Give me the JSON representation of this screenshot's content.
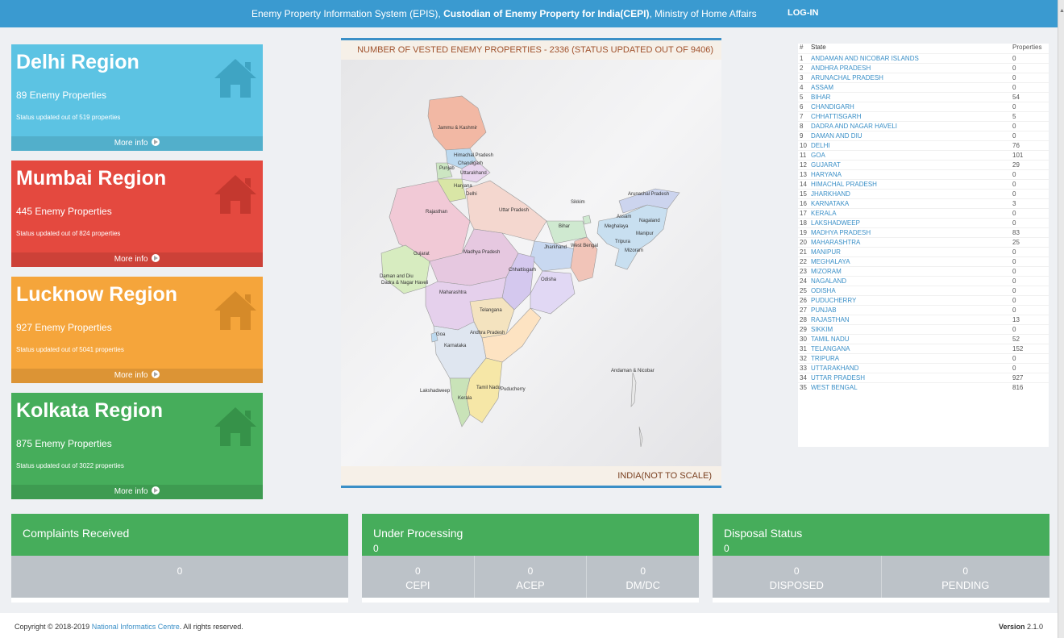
{
  "header": {
    "title_part1": "Enemy Property Information System (EPIS), ",
    "title_bold": "Custodian of Enemy Property for India(CEPI)",
    "title_part2": ", Ministry of Home Affairs",
    "login_label": "LOG-IN",
    "color": "#3a9ad0"
  },
  "regions": [
    {
      "name": "Delhi Region",
      "count": "89 Enemy Properties",
      "status": "Status updated out of 519 properties",
      "more": "More info",
      "color": "#5cc3e3"
    },
    {
      "name": "Mumbai Region",
      "count": "445 Enemy Properties",
      "status": "Status updated out of 824 properties",
      "more": "More info",
      "color": "#e4493f"
    },
    {
      "name": "Lucknow Region",
      "count": "927 Enemy Properties",
      "status": "Status updated out of 5041 properties",
      "more": "More info",
      "color": "#f5a53b"
    },
    {
      "name": "Kolkata Region",
      "count": "875 Enemy Properties",
      "status": "Status updated out of 3022 properties",
      "more": "More info",
      "color": "#46ad5b"
    }
  ],
  "map": {
    "heading": "NUMBER OF VESTED ENEMY PROPERTIES - 2336 (STATUS UPDATED OUT OF 9406)",
    "footer": "INDIA(NOT TO SCALE)",
    "labels": [
      "Jammu & Kashmir",
      "Himachal Pradesh",
      "Punjab",
      "Chandigarh",
      "Uttarakhand",
      "Haryana",
      "Delhi",
      "Rajasthan",
      "Uttar Pradesh",
      "Sikkim",
      "Arunachal Pradesh",
      "Bihar",
      "Assam",
      "Nagaland",
      "Meghalaya",
      "Manipur",
      "Tripura",
      "Mizoram",
      "Jharkhand",
      "West Bengal",
      "Gujarat",
      "Madhya Pradesh",
      "Chhattisgarh",
      "Daman and Diu",
      "Dadra & Nagar Haveli",
      "Odisha",
      "Maharashtra",
      "Telangana",
      "Goa",
      "Andhra Pradesh",
      "Karnataka",
      "Andaman & Nicobar",
      "Lakshadweep",
      "Tamil Nadu",
      "Puducherry",
      "Kerala"
    ]
  },
  "state_table": {
    "headers": [
      "#",
      "State",
      "Properties"
    ],
    "rows": [
      [
        "1",
        "ANDAMAN AND NICOBAR ISLANDS",
        "0"
      ],
      [
        "2",
        "ANDHRA PRADESH",
        "0"
      ],
      [
        "3",
        "ARUNACHAL PRADESH",
        "0"
      ],
      [
        "4",
        "ASSAM",
        "0"
      ],
      [
        "5",
        "BIHAR",
        "54"
      ],
      [
        "6",
        "CHANDIGARH",
        "0"
      ],
      [
        "7",
        "CHHATTISGARH",
        "5"
      ],
      [
        "8",
        "DADRA AND NAGAR HAVELI",
        "0"
      ],
      [
        "9",
        "DAMAN AND DIU",
        "0"
      ],
      [
        "10",
        "DELHI",
        "76"
      ],
      [
        "11",
        "GOA",
        "101"
      ],
      [
        "12",
        "GUJARAT",
        "29"
      ],
      [
        "13",
        "HARYANA",
        "0"
      ],
      [
        "14",
        "HIMACHAL PRADESH",
        "0"
      ],
      [
        "15",
        "JHARKHAND",
        "0"
      ],
      [
        "16",
        "KARNATAKA",
        "3"
      ],
      [
        "17",
        "KERALA",
        "0"
      ],
      [
        "18",
        "LAKSHADWEEP",
        "0"
      ],
      [
        "19",
        "MADHYA PRADESH",
        "83"
      ],
      [
        "20",
        "MAHARASHTRA",
        "25"
      ],
      [
        "21",
        "MANIPUR",
        "0"
      ],
      [
        "22",
        "MEGHALAYA",
        "0"
      ],
      [
        "23",
        "MIZORAM",
        "0"
      ],
      [
        "24",
        "NAGALAND",
        "0"
      ],
      [
        "25",
        "ODISHA",
        "0"
      ],
      [
        "26",
        "PUDUCHERRY",
        "0"
      ],
      [
        "27",
        "PUNJAB",
        "0"
      ],
      [
        "28",
        "RAJASTHAN",
        "13"
      ],
      [
        "29",
        "SIKKIM",
        "0"
      ],
      [
        "30",
        "TAMIL NADU",
        "52"
      ],
      [
        "31",
        "TELANGANA",
        "152"
      ],
      [
        "32",
        "TRIPURA",
        "0"
      ],
      [
        "33",
        "UTTARAKHAND",
        "0"
      ],
      [
        "34",
        "UTTAR PRADESH",
        "927"
      ],
      [
        "35",
        "WEST BENGAL",
        "816"
      ]
    ]
  },
  "stats": {
    "complaints": {
      "title": "Complaints Received",
      "cells": [
        {
          "value": "0",
          "label": ""
        }
      ]
    },
    "processing": {
      "title": "Under Processing",
      "sub": "0",
      "cells": [
        {
          "value": "0",
          "label": "CEPI"
        },
        {
          "value": "0",
          "label": "ACEP"
        },
        {
          "value": "0",
          "label": "DM/DC"
        }
      ]
    },
    "disposal": {
      "title": "Disposal Status",
      "sub": "0",
      "cells": [
        {
          "value": "0",
          "label": "DISPOSED"
        },
        {
          "value": "0",
          "label": "PENDING"
        }
      ]
    }
  },
  "footer": {
    "copyright_prefix": "Copyright © 2018-2019 ",
    "org": "National Informatics Centre",
    "copyright_suffix": ". All rights reserved.",
    "version_label": "Version",
    "version": "2.1.0"
  }
}
